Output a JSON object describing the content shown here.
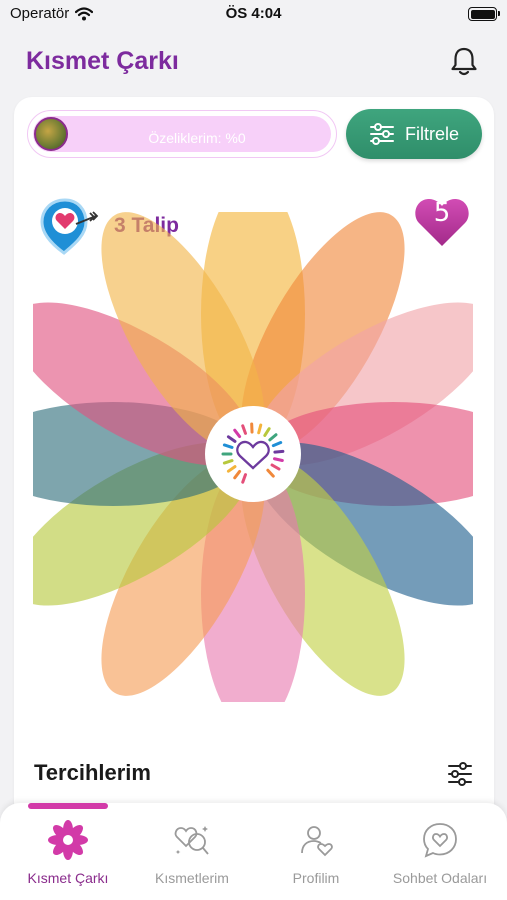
{
  "status_bar": {
    "carrier": "Operatör",
    "time": "ÖS 4:04"
  },
  "header": {
    "title": "Kısmet Çarkı",
    "icon": "bell-icon"
  },
  "profile_progress": {
    "label": "Özeliklerim: %0",
    "value_percent": 0
  },
  "filter_button": {
    "label": "Filtrele",
    "icon": "sliders-icon"
  },
  "suitors": {
    "label": "3 Talip",
    "icon": "heart-pin-icon"
  },
  "likes_badge": {
    "count": "5",
    "color": "#c43a9f"
  },
  "wheel": {
    "center_icon": "heart-logo-icon",
    "petal_colors": [
      "#f4b43a",
      "#f0883a",
      "#f0a3a8",
      "#e44f7a",
      "#1e5f8e",
      "#c2d144",
      "#e97ab0",
      "#f59c56",
      "#b7c83c",
      "#2e6d7a",
      "#e0527f",
      "#f2b449"
    ]
  },
  "preferences": {
    "title": "Tercihlerim",
    "icon": "sliders-icon"
  },
  "tabs": [
    {
      "label": "Kısmet Çarkı",
      "icon": "flower-icon",
      "active": true
    },
    {
      "label": "Kısmetlerim",
      "icon": "hearts-search-icon",
      "active": false
    },
    {
      "label": "Profilim",
      "icon": "user-heart-icon",
      "active": false
    },
    {
      "label": "Sohbet Odaları",
      "icon": "chat-heart-icon",
      "active": false
    }
  ],
  "colors": {
    "brand_purple": "#7d2b9e",
    "filter_green": "#3a9e78",
    "tab_active": "#8a2c8c",
    "tab_indicator": "#d23aa8"
  }
}
